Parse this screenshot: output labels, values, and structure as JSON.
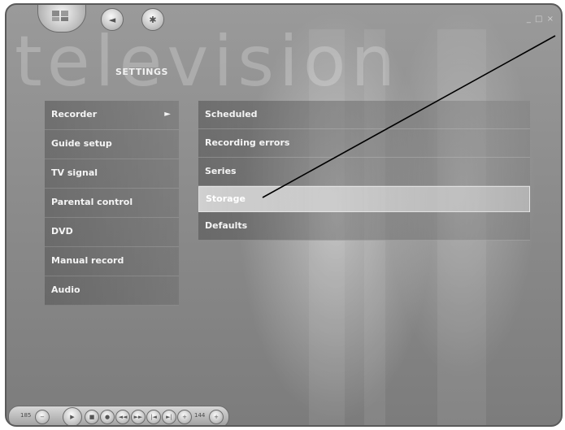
{
  "window": {
    "watermark": "television",
    "controls": "_ □ ×"
  },
  "header": {
    "title": "SETTINGS"
  },
  "left_menu": {
    "items": [
      {
        "label": "Recorder",
        "selected": true
      },
      {
        "label": "Guide setup"
      },
      {
        "label": "TV signal"
      },
      {
        "label": "Parental control"
      },
      {
        "label": "DVD"
      },
      {
        "label": "Manual record"
      },
      {
        "label": "Audio"
      }
    ],
    "expand_arrow": "►"
  },
  "right_menu": {
    "items": [
      {
        "label": "Scheduled"
      },
      {
        "label": "Recording errors"
      },
      {
        "label": "Series"
      },
      {
        "label": "Storage",
        "selected": true
      },
      {
        "label": "Defaults"
      }
    ]
  },
  "transport": {
    "left_label": "185",
    "right_label": "144"
  }
}
